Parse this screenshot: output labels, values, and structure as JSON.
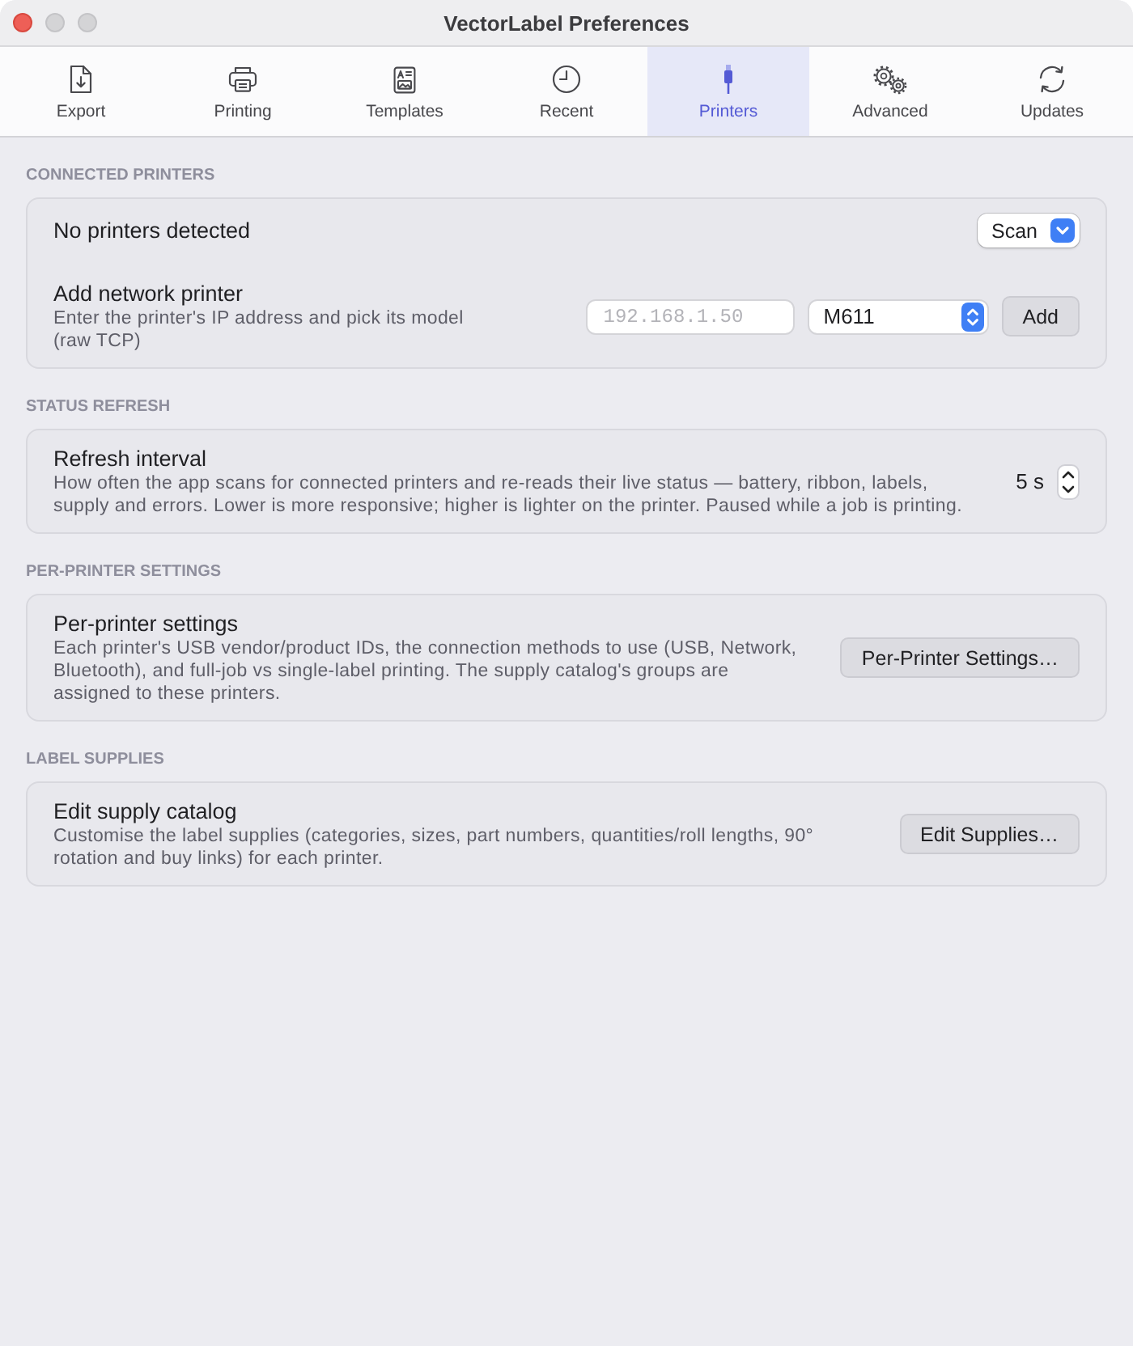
{
  "window": {
    "title": "VectorLabel Preferences"
  },
  "tabs": [
    {
      "label": "Export",
      "kind": "export",
      "selected": false
    },
    {
      "label": "Printing",
      "kind": "printer",
      "selected": false
    },
    {
      "label": "Templates",
      "kind": "template",
      "selected": false
    },
    {
      "label": "Recent",
      "kind": "clock",
      "selected": false
    },
    {
      "label": "Printers",
      "kind": "plug",
      "selected": true
    },
    {
      "label": "Advanced",
      "kind": "gears",
      "selected": false
    },
    {
      "label": "Updates",
      "kind": "refresh",
      "selected": false
    }
  ],
  "sections": [
    {
      "heading": "CONNECTED PRINTERS",
      "rows": [
        {
          "title": "No printers detected",
          "controls": [
            {
              "kind": "pulldown",
              "label": "Scan"
            }
          ]
        },
        {
          "title": "Add network printer",
          "description": "Enter the printer's IP address and pick its model (raw TCP)",
          "controls": [
            {
              "kind": "field",
              "placeholder": "192.168.1.50"
            },
            {
              "kind": "popup",
              "value": "M611"
            },
            {
              "kind": "button",
              "label": "Add"
            }
          ]
        }
      ]
    },
    {
      "heading": "STATUS REFRESH",
      "rows": [
        {
          "title": "Refresh interval",
          "description": "How often the app scans for connected printers and re-reads their live status — battery, ribbon, labels, supply and errors. Lower is more responsive; higher is lighter on the printer. Paused while a job is printing.",
          "controls": [
            {
              "kind": "value",
              "text": "5 s"
            },
            {
              "kind": "stepper"
            }
          ]
        }
      ]
    },
    {
      "heading": "PER-PRINTER SETTINGS",
      "rows": [
        {
          "title": "Per-printer settings",
          "description": "Each printer's USB vendor/product IDs, the connection methods to use (USB, Network, Bluetooth), and full-job vs single-label printing. The supply catalog's groups are assigned to these printers.",
          "controls": [
            {
              "kind": "button",
              "label": "Per-Printer Settings…"
            }
          ]
        }
      ]
    },
    {
      "heading": "LABEL SUPPLIES",
      "rows": [
        {
          "title": "Edit supply catalog",
          "description": "Customise the label supplies (categories, sizes, part numbers, quantities/roll lengths, 90° rotation and buy links) for each printer.",
          "controls": [
            {
              "kind": "button",
              "label": "Edit Supplies…"
            }
          ]
        }
      ]
    }
  ]
}
